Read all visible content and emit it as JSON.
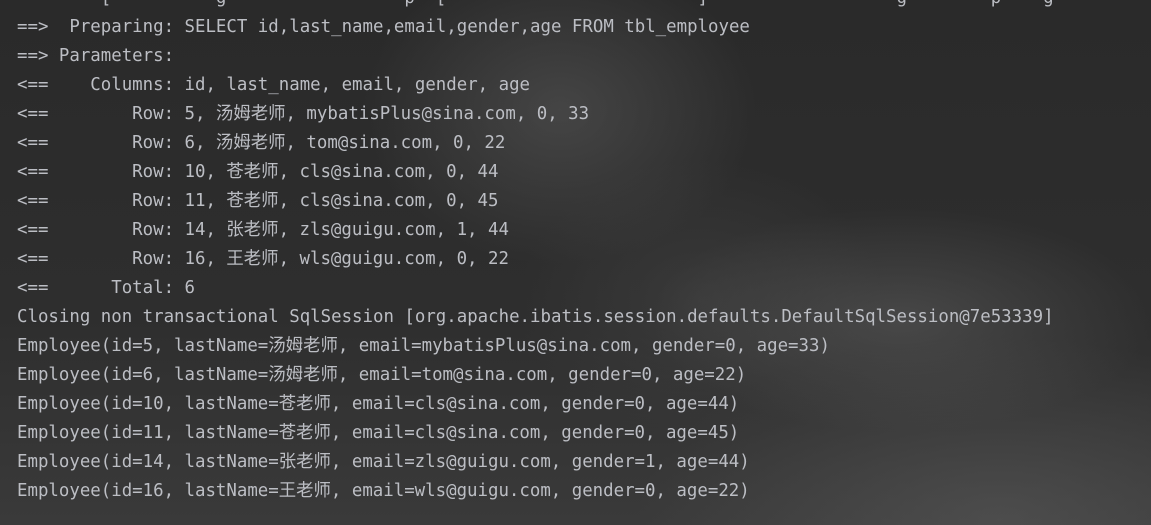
{
  "console": {
    "lines": [
      "        [          g                 p  [                        ]                  g        p    g",
      "==>  Preparing: SELECT id,last_name,email,gender,age FROM tbl_employee",
      "==> Parameters: ",
      "<==    Columns: id, last_name, email, gender, age",
      "<==        Row: 5, 汤姆老师, mybatisPlus@sina.com, 0, 33",
      "<==        Row: 6, 汤姆老师, tom@sina.com, 0, 22",
      "<==        Row: 10, 苍老师, cls@sina.com, 0, 44",
      "<==        Row: 11, 苍老师, cls@sina.com, 0, 45",
      "<==        Row: 14, 张老师, zls@guigu.com, 1, 44",
      "<==        Row: 16, 王老师, wls@guigu.com, 0, 22",
      "<==      Total: 6",
      "Closing non transactional SqlSession [org.apache.ibatis.session.defaults.DefaultSqlSession@7e53339]",
      "Employee(id=5, lastName=汤姆老师, email=mybatisPlus@sina.com, gender=0, age=33)",
      "Employee(id=6, lastName=汤姆老师, email=tom@sina.com, gender=0, age=22)",
      "Employee(id=10, lastName=苍老师, email=cls@sina.com, gender=0, age=44)",
      "Employee(id=11, lastName=苍老师, email=cls@sina.com, gender=0, age=45)",
      "Employee(id=14, lastName=张老师, email=zls@guigu.com, gender=1, age=44)",
      "Employee(id=16, lastName=王老师, email=wls@guigu.com, gender=0, age=22)"
    ]
  },
  "colors": {
    "text": "#bcbec4",
    "background": "#2b2b2b"
  }
}
